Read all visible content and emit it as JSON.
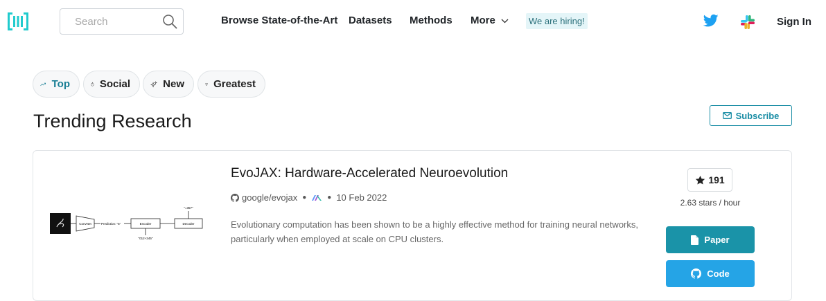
{
  "nav": {
    "logo_icon": "papers-with-code-logo",
    "search_placeholder": "Search",
    "links": [
      "Browse State-of-the-Art",
      "Datasets",
      "Methods",
      "More"
    ],
    "hiring": "We are hiring!",
    "sign_in": "Sign In"
  },
  "filters": [
    {
      "label": "Top",
      "icon": "trending-up-icon",
      "active": true
    },
    {
      "label": "Social",
      "icon": "flame-icon"
    },
    {
      "label": "New",
      "icon": "sparkles-icon"
    },
    {
      "label": "Greatest",
      "icon": "trophy-icon"
    }
  ],
  "page": {
    "title": "Trending Research",
    "subscribe": "Subscribe"
  },
  "paper": {
    "title": "EvoJAX: Hardware-Accelerated Neuroevolution",
    "repo": "google/evojax",
    "date": "10 Feb 2022",
    "abstract": "Evolutionary computation has been shown to be a highly effective method for training neural networks, particularly when employed at scale on CPU clusters.",
    "stars": "191",
    "stars_rate": "2.63 stars / hour",
    "paper_button": "Paper",
    "code_button": "Code",
    "thumbnail": {
      "convnet": "ConvNet",
      "prediction": "Prediction: \"5\"",
      "encoder": "Encoder",
      "decoder": "Decoder",
      "output": "\"=357\"",
      "input": "\"012+345\""
    }
  },
  "colors": {
    "accent": "#1a8da5",
    "paper_button": "#1a93a8",
    "code_button": "#25a4e6",
    "twitter": "#1da1f2"
  }
}
